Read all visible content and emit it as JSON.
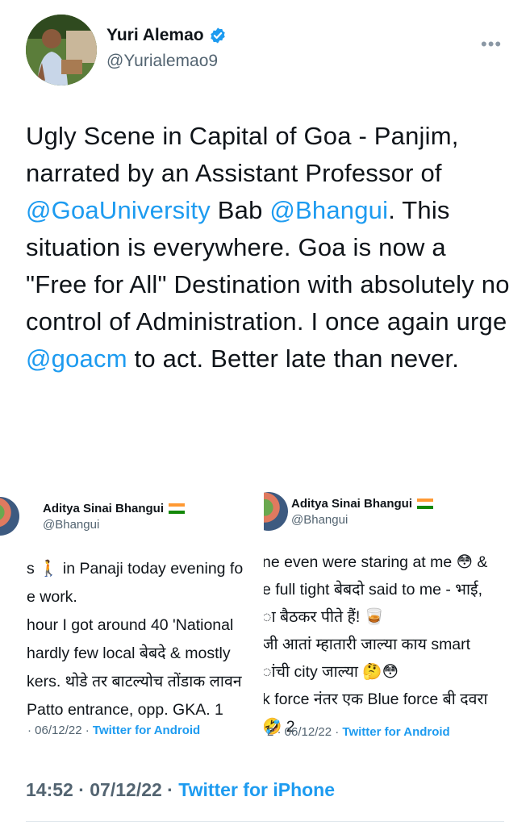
{
  "author": {
    "name": "Yuri Alemao",
    "handle": "@Yurialemao9",
    "verified": true
  },
  "tweet": {
    "segments": [
      {
        "text": "Ugly Scene in Capital of Goa - Panjim, narrated by an Assistant Professor of ",
        "mention": false
      },
      {
        "text": "@GoaUniversity",
        "mention": true
      },
      {
        "text": " Bab ",
        "mention": false
      },
      {
        "text": "@Bhangui",
        "mention": true
      },
      {
        "text": ". This situation is everywhere. Goa is now a \"Free for All\" Destination with absolutely no control of Administration. I once again urge ",
        "mention": false
      },
      {
        "text": "@goacm",
        "mention": true
      },
      {
        "text": " to act. Better late than never.",
        "mention": false
      }
    ]
  },
  "embedded_left": {
    "name": "Aditya Sinai Bhangui",
    "handle": "@Bhangui",
    "lines": [
      "s 🚶 in Panaji today evening fo",
      "e work.",
      "hour I got around 40 'National",
      " hardly few local बेबदे & mostly",
      "kers. थोडे तर बाटल्योच तोंडाक लावन",
      " Patto entrance, opp. GKA. 1"
    ],
    "meta_date": "· 06/12/22 ·",
    "meta_source": "Twitter for Android"
  },
  "embedded_right": {
    "name": "Aditya Sinai Bhangui",
    "handle": "@Bhangui",
    "lines": [
      "ne even were staring at me 😳 &",
      "e full tight बेबदो said to me - भाई,",
      "ा बैठकर पीते हैं! 🥃",
      "जी आतां म्हातारी जाल्या काय smart",
      "ांची city जाल्या 🤔😳",
      "k force नंतर एक Blue force बी दवरा",
      "🤣 2"
    ],
    "meta_date": "2 · 06/12/22 ·",
    "meta_source": "Twitter for Android"
  },
  "footer": {
    "time": "14:52 · 07/12/22 ·",
    "source": "Twitter for iPhone"
  },
  "colors": {
    "link": "#1d9bf0",
    "text": "#0f1419",
    "muted": "#536471"
  }
}
